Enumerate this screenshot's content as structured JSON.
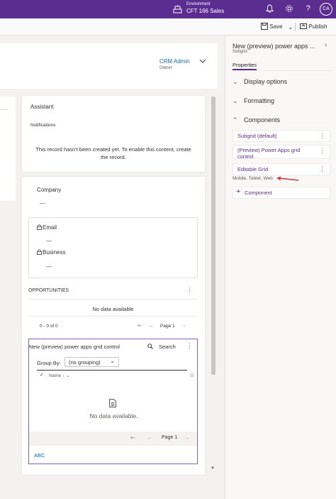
{
  "topbar": {
    "env_label": "Environment",
    "env_name": "CFT 166 Sales",
    "avatar_initials": "CA",
    "bell_icon": "bell-icon",
    "settings_icon": "gear-icon",
    "help_icon": "question-icon"
  },
  "cmdbar": {
    "save_label": "Save",
    "publish_label": "Publish"
  },
  "header": {
    "owner_name": "CRM Admin",
    "owner_label": "Owner"
  },
  "assistant": {
    "title": "Assistant",
    "notifications": "Notifications",
    "message": "This record hasn't been created yet. To enable this content, create the record."
  },
  "details": {
    "company_label": "Company",
    "company_value": "---",
    "email_label": "Email",
    "email_value": "---",
    "business_label": "Business",
    "business_value": "---"
  },
  "opportunities": {
    "title": "OPPORTUNITIES",
    "empty": "No data available",
    "count": "0 - 0 of 0",
    "page": "Page 1"
  },
  "grid": {
    "title": "New (preview) power apps grid control",
    "search_label": "Search",
    "group_by_label": "Group By:",
    "group_by_value": "(no grouping)",
    "column_name": "Name",
    "empty": "No data available.",
    "page": "Page 1",
    "footer_link": "ABC"
  },
  "panel": {
    "title": "New (preview) power apps ...",
    "subtitle": "Subgrid",
    "tab": "Properties",
    "sections": [
      "Display options",
      "Formatting",
      "Components"
    ],
    "components": [
      "Subgrid (default)",
      "(Preview) Power Apps grid control",
      "Editable Grid"
    ],
    "editable_grid_note": "Mobile, Tablet, Web",
    "add_component": "Component"
  },
  "colors": {
    "brand": "#5c2d91",
    "link": "#0f6cbd",
    "annotation_arrow": "#d13438"
  }
}
